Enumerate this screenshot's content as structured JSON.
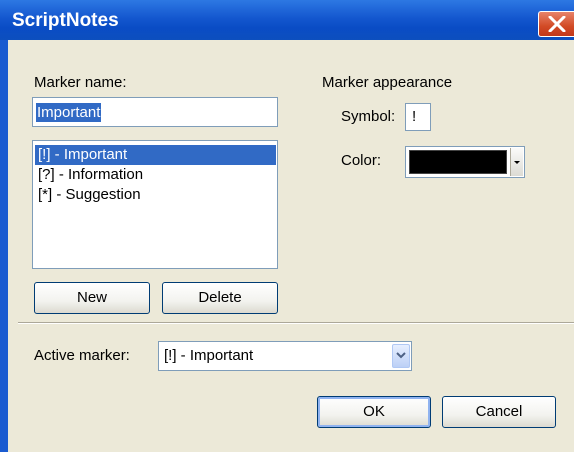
{
  "window": {
    "title": "ScriptNotes"
  },
  "marker_name": {
    "label": "Marker name:",
    "value": "Important"
  },
  "marker_list": {
    "items": [
      {
        "label": "[!] - Important",
        "selected": true
      },
      {
        "label": "[?] - Information",
        "selected": false
      },
      {
        "label": "[*] - Suggestion",
        "selected": false
      }
    ]
  },
  "buttons": {
    "new": "New",
    "delete": "Delete",
    "ok": "OK",
    "cancel": "Cancel"
  },
  "appearance": {
    "heading": "Marker appearance",
    "symbol_label": "Symbol:",
    "symbol_value": "!",
    "color_label": "Color:",
    "color_value": "#000000"
  },
  "active_marker": {
    "label": "Active marker:",
    "value": "[!] - Important"
  },
  "colors": {
    "title_bar": "#0a4cc5",
    "dialog_bg": "#ece9d8",
    "selection": "#316ac5"
  },
  "icons": {
    "close": "close-icon",
    "dropdown": "chevron-down-icon"
  }
}
